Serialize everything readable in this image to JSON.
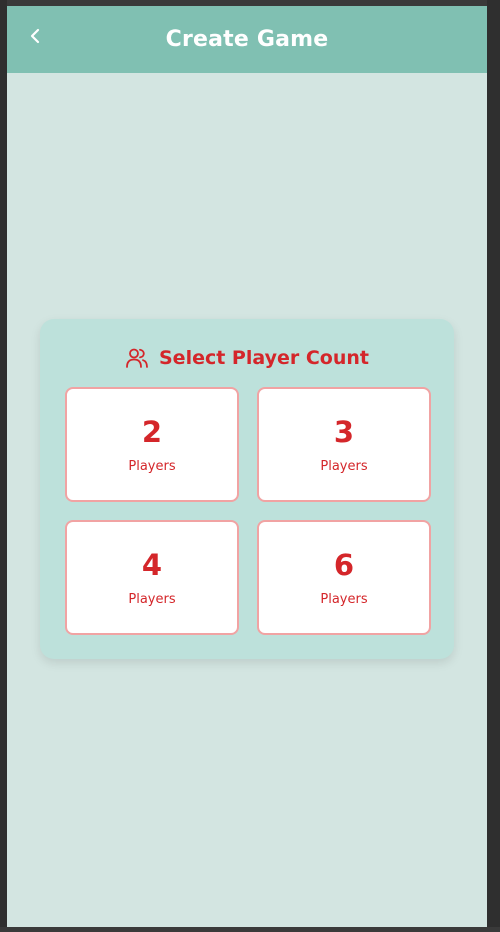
{
  "header": {
    "title": "Create Game",
    "back_icon": "chevron-left-icon"
  },
  "card": {
    "title": "Select Player Count",
    "icon": "users-icon",
    "options": [
      {
        "number": "2",
        "label": "Players"
      },
      {
        "number": "3",
        "label": "Players"
      },
      {
        "number": "4",
        "label": "Players"
      },
      {
        "number": "6",
        "label": "Players"
      }
    ]
  },
  "colors": {
    "header_bg": "#80c0b2",
    "page_bg": "#d3e5e1",
    "card_bg": "#bde1db",
    "accent": "#d4262a",
    "option_border": "#f1a3a3"
  }
}
